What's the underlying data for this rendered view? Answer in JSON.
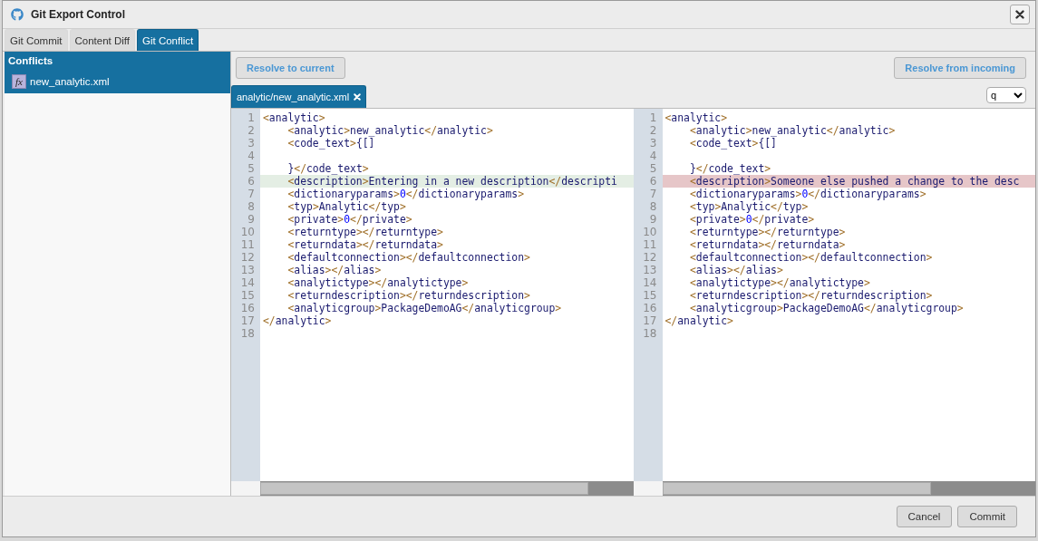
{
  "window": {
    "title": "Git Export Control"
  },
  "tabs": [
    {
      "label": "Git Commit",
      "selected": false
    },
    {
      "label": "Content Diff",
      "selected": false
    },
    {
      "label": "Git Conflict",
      "selected": true
    }
  ],
  "sidebar": {
    "title": "Conflicts",
    "items": [
      {
        "badge": "fx",
        "label": "new_analytic.xml",
        "selected": true
      }
    ]
  },
  "toolbar": {
    "left_button": "Resolve to current",
    "right_button": "Resolve from incoming"
  },
  "file_tab": {
    "label": "analytic/new_analytic.xml"
  },
  "mode_select": {
    "value": "q"
  },
  "panes": [
    {
      "kind": "current",
      "lines": [
        {
          "number": "1",
          "text": "<analytic>",
          "changed": false
        },
        {
          "number": "2",
          "text": "    <analytic>new_analytic</analytic>",
          "changed": false
        },
        {
          "number": "3",
          "text": "    <code_text>{[]",
          "changed": false
        },
        {
          "number": "4",
          "changed": false
        },
        {
          "number": "5",
          "text": "    }</code_text>",
          "changed": false
        },
        {
          "number": "6",
          "text": "    <description>Entering in a new description</descripti",
          "changed": true
        },
        {
          "number": "7",
          "text": "    <dictionaryparams>0</dictionaryparams>",
          "changed": false
        },
        {
          "number": "8",
          "text": "    <typ>Analytic</typ>",
          "changed": false
        },
        {
          "number": "9",
          "text": "    <private>0</private>",
          "changed": false
        },
        {
          "number": "10",
          "text": "    <returntype></returntype>",
          "changed": false
        },
        {
          "number": "11",
          "text": "    <returndata></returndata>",
          "changed": false
        },
        {
          "number": "12",
          "text": "    <defaultconnection></defaultconnection>",
          "changed": false
        },
        {
          "number": "13",
          "text": "    <alias></alias>",
          "changed": false
        },
        {
          "number": "14",
          "text": "    <analytictype></analytictype>",
          "changed": false
        },
        {
          "number": "15",
          "text": "    <returndescription></returndescription>",
          "changed": false
        },
        {
          "number": "16",
          "text": "    <analyticgroup>PackageDemoAG</analyticgroup>",
          "changed": false
        },
        {
          "number": "17",
          "text": "</analytic>",
          "changed": false
        },
        {
          "number": "18",
          "changed": false
        }
      ]
    },
    {
      "kind": "incoming",
      "lines": [
        {
          "number": "1",
          "text": "<analytic>",
          "changed": false
        },
        {
          "number": "2",
          "text": "    <analytic>new_analytic</analytic>",
          "changed": false
        },
        {
          "number": "3",
          "text": "    <code_text>{[]",
          "changed": false
        },
        {
          "number": "4",
          "changed": false
        },
        {
          "number": "5",
          "text": "    }</code_text>",
          "changed": false
        },
        {
          "number": "6",
          "text": "    <description>Someone else pushed a change to the desc",
          "changed": true
        },
        {
          "number": "7",
          "text": "    <dictionaryparams>0</dictionaryparams>",
          "changed": false
        },
        {
          "number": "8",
          "text": "    <typ>Analytic</typ>",
          "changed": false
        },
        {
          "number": "9",
          "text": "    <private>0</private>",
          "changed": false
        },
        {
          "number": "10",
          "text": "    <returntype></returntype>",
          "changed": false
        },
        {
          "number": "11",
          "text": "    <returndata></returndata>",
          "changed": false
        },
        {
          "number": "12",
          "text": "    <defaultconnection></defaultconnection>",
          "changed": false
        },
        {
          "number": "13",
          "text": "    <alias></alias>",
          "changed": false
        },
        {
          "number": "14",
          "text": "    <analytictype></analytictype>",
          "changed": false
        },
        {
          "number": "15",
          "text": "    <returndescription></returndescription>",
          "changed": false
        },
        {
          "number": "16",
          "text": "    <analyticgroup>PackageDemoAG</analyticgroup>",
          "changed": false
        },
        {
          "number": "17",
          "text": "</analytic>",
          "changed": false
        },
        {
          "number": "18",
          "changed": false
        }
      ]
    }
  ],
  "footer": {
    "buttons": [
      "Cancel",
      "Commit"
    ]
  }
}
